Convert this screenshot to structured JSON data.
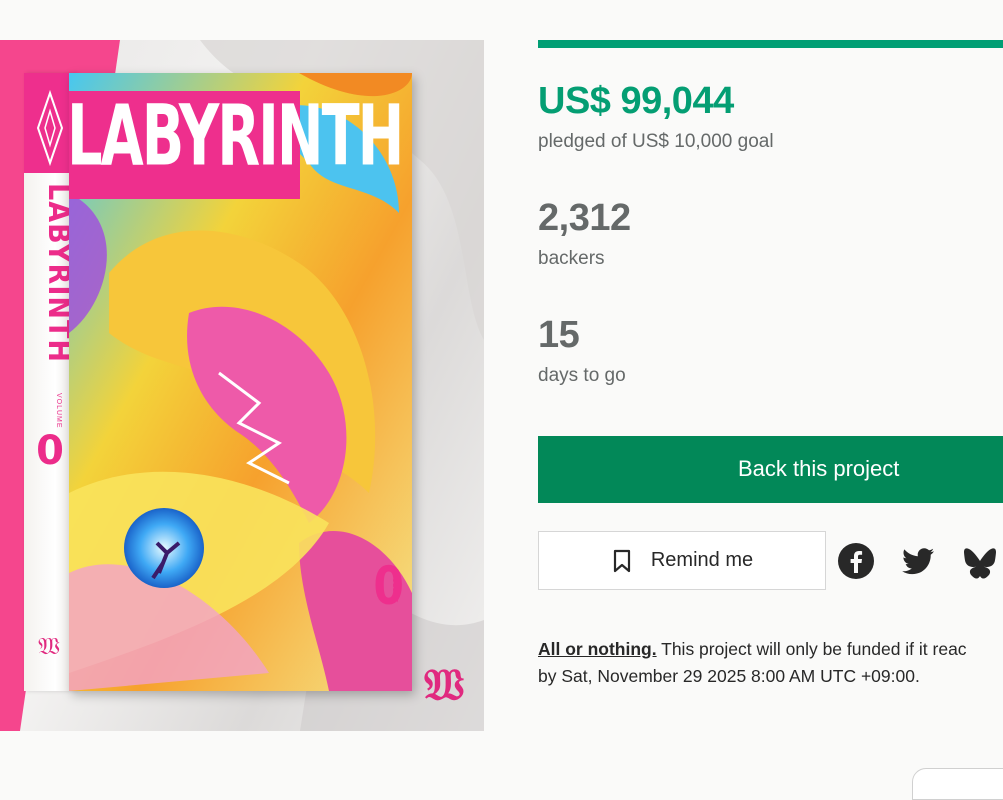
{
  "artwork": {
    "cover_title": "LABYRINTH",
    "spine_title": "LABYRINTH",
    "volume_label": "VOLUME",
    "volume_number": "0"
  },
  "funding": {
    "progress_fraction": 1.0,
    "amount": "US$ 99,044",
    "goal_text": "pledged of US$ 10,000 goal"
  },
  "stats": {
    "backers_value": "2,312",
    "backers_label": "backers",
    "days_value": "15",
    "days_label": "days to go"
  },
  "actions": {
    "back_label": "Back this project",
    "remind_label": "Remind me"
  },
  "social": [
    "facebook-icon",
    "twitter-icon",
    "bluesky-icon"
  ],
  "notice": {
    "strong": "All or nothing.",
    "text": " This project will only be funded if it reac",
    "line2": "by Sat, November 29 2025 8:00 AM UTC +09:00."
  },
  "colors": {
    "accent": "#009e74",
    "button": "#028858",
    "pink": "#ee2f8d"
  }
}
